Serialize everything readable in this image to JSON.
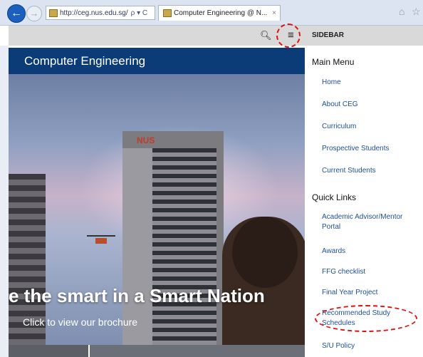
{
  "browser": {
    "url": "http://ceg.nus.edu.sg/",
    "url_controls": "ρ ▾ C",
    "tab_title": "Computer Engineering @ N...",
    "tab_close": "×"
  },
  "page": {
    "header_title": "Computer Engineering",
    "hero_headline": "e the smart in a Smart Nation",
    "hero_link": "Click to view our brochure",
    "hero_sign": "NUS"
  },
  "sidebar": {
    "title": "SIDEBAR",
    "main_menu_title": "Main Menu",
    "main_menu": [
      "Home",
      "About CEG",
      "Curriculum",
      "Prospective Students",
      "Current Students"
    ],
    "quick_links_title": "Quick Links",
    "quick_links": [
      "Academic Advisor/Mentor Portal",
      "Awards",
      "FFG checklist",
      "Final Year Project",
      "Recommended Study Schedules",
      "S/U Policy"
    ]
  },
  "colors": {
    "header_bg": "#0b3c77",
    "link": "#1f4f95",
    "annotation": "#e01010"
  },
  "icons": [
    "back-arrow-icon",
    "forward-arrow-icon",
    "search-icon",
    "hamburger-menu-icon",
    "home-icon",
    "star-icon"
  ]
}
